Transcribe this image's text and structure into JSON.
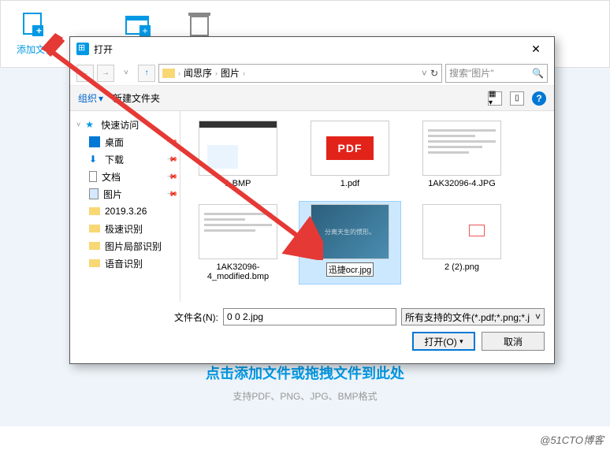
{
  "toolbar": {
    "add_file": "添加文件",
    "trash": ""
  },
  "drop": {
    "title": "点击添加文件或拖拽文件到此处",
    "subtitle": "支持PDF、PNG、JPG、BMP格式"
  },
  "dialog": {
    "title": "打开",
    "breadcrumb": {
      "part1": "闻思序",
      "part2": "图片"
    },
    "search_placeholder": "搜索\"图片\"",
    "organize": "组织",
    "new_folder": "新建文件夹",
    "filename_label": "文件名(N):",
    "filename_value": "0 0 2.jpg",
    "filter": "所有支持的文件(*.pdf;*.png;*.j",
    "open_btn": "打开(O)",
    "cancel_btn": "取消"
  },
  "sidebar": {
    "quick_access": "快速访问",
    "desktop": "桌面",
    "downloads": "下载",
    "documents": "文档",
    "pictures": "图片",
    "f1": "2019.3.26",
    "f2": "极速识别",
    "f3": "图片局部识别",
    "f4": "语音识别"
  },
  "files": {
    "n1": "1.BMP",
    "n2": "1.pdf",
    "n3": "1AK32096-4.JPG",
    "n4": "1AK32096-4_modified.bmp",
    "n5": "迅捷ocr.jpg",
    "n6": "2 (2).png",
    "pdf_badge": "PDF"
  },
  "watermark": "@51CTO博客"
}
